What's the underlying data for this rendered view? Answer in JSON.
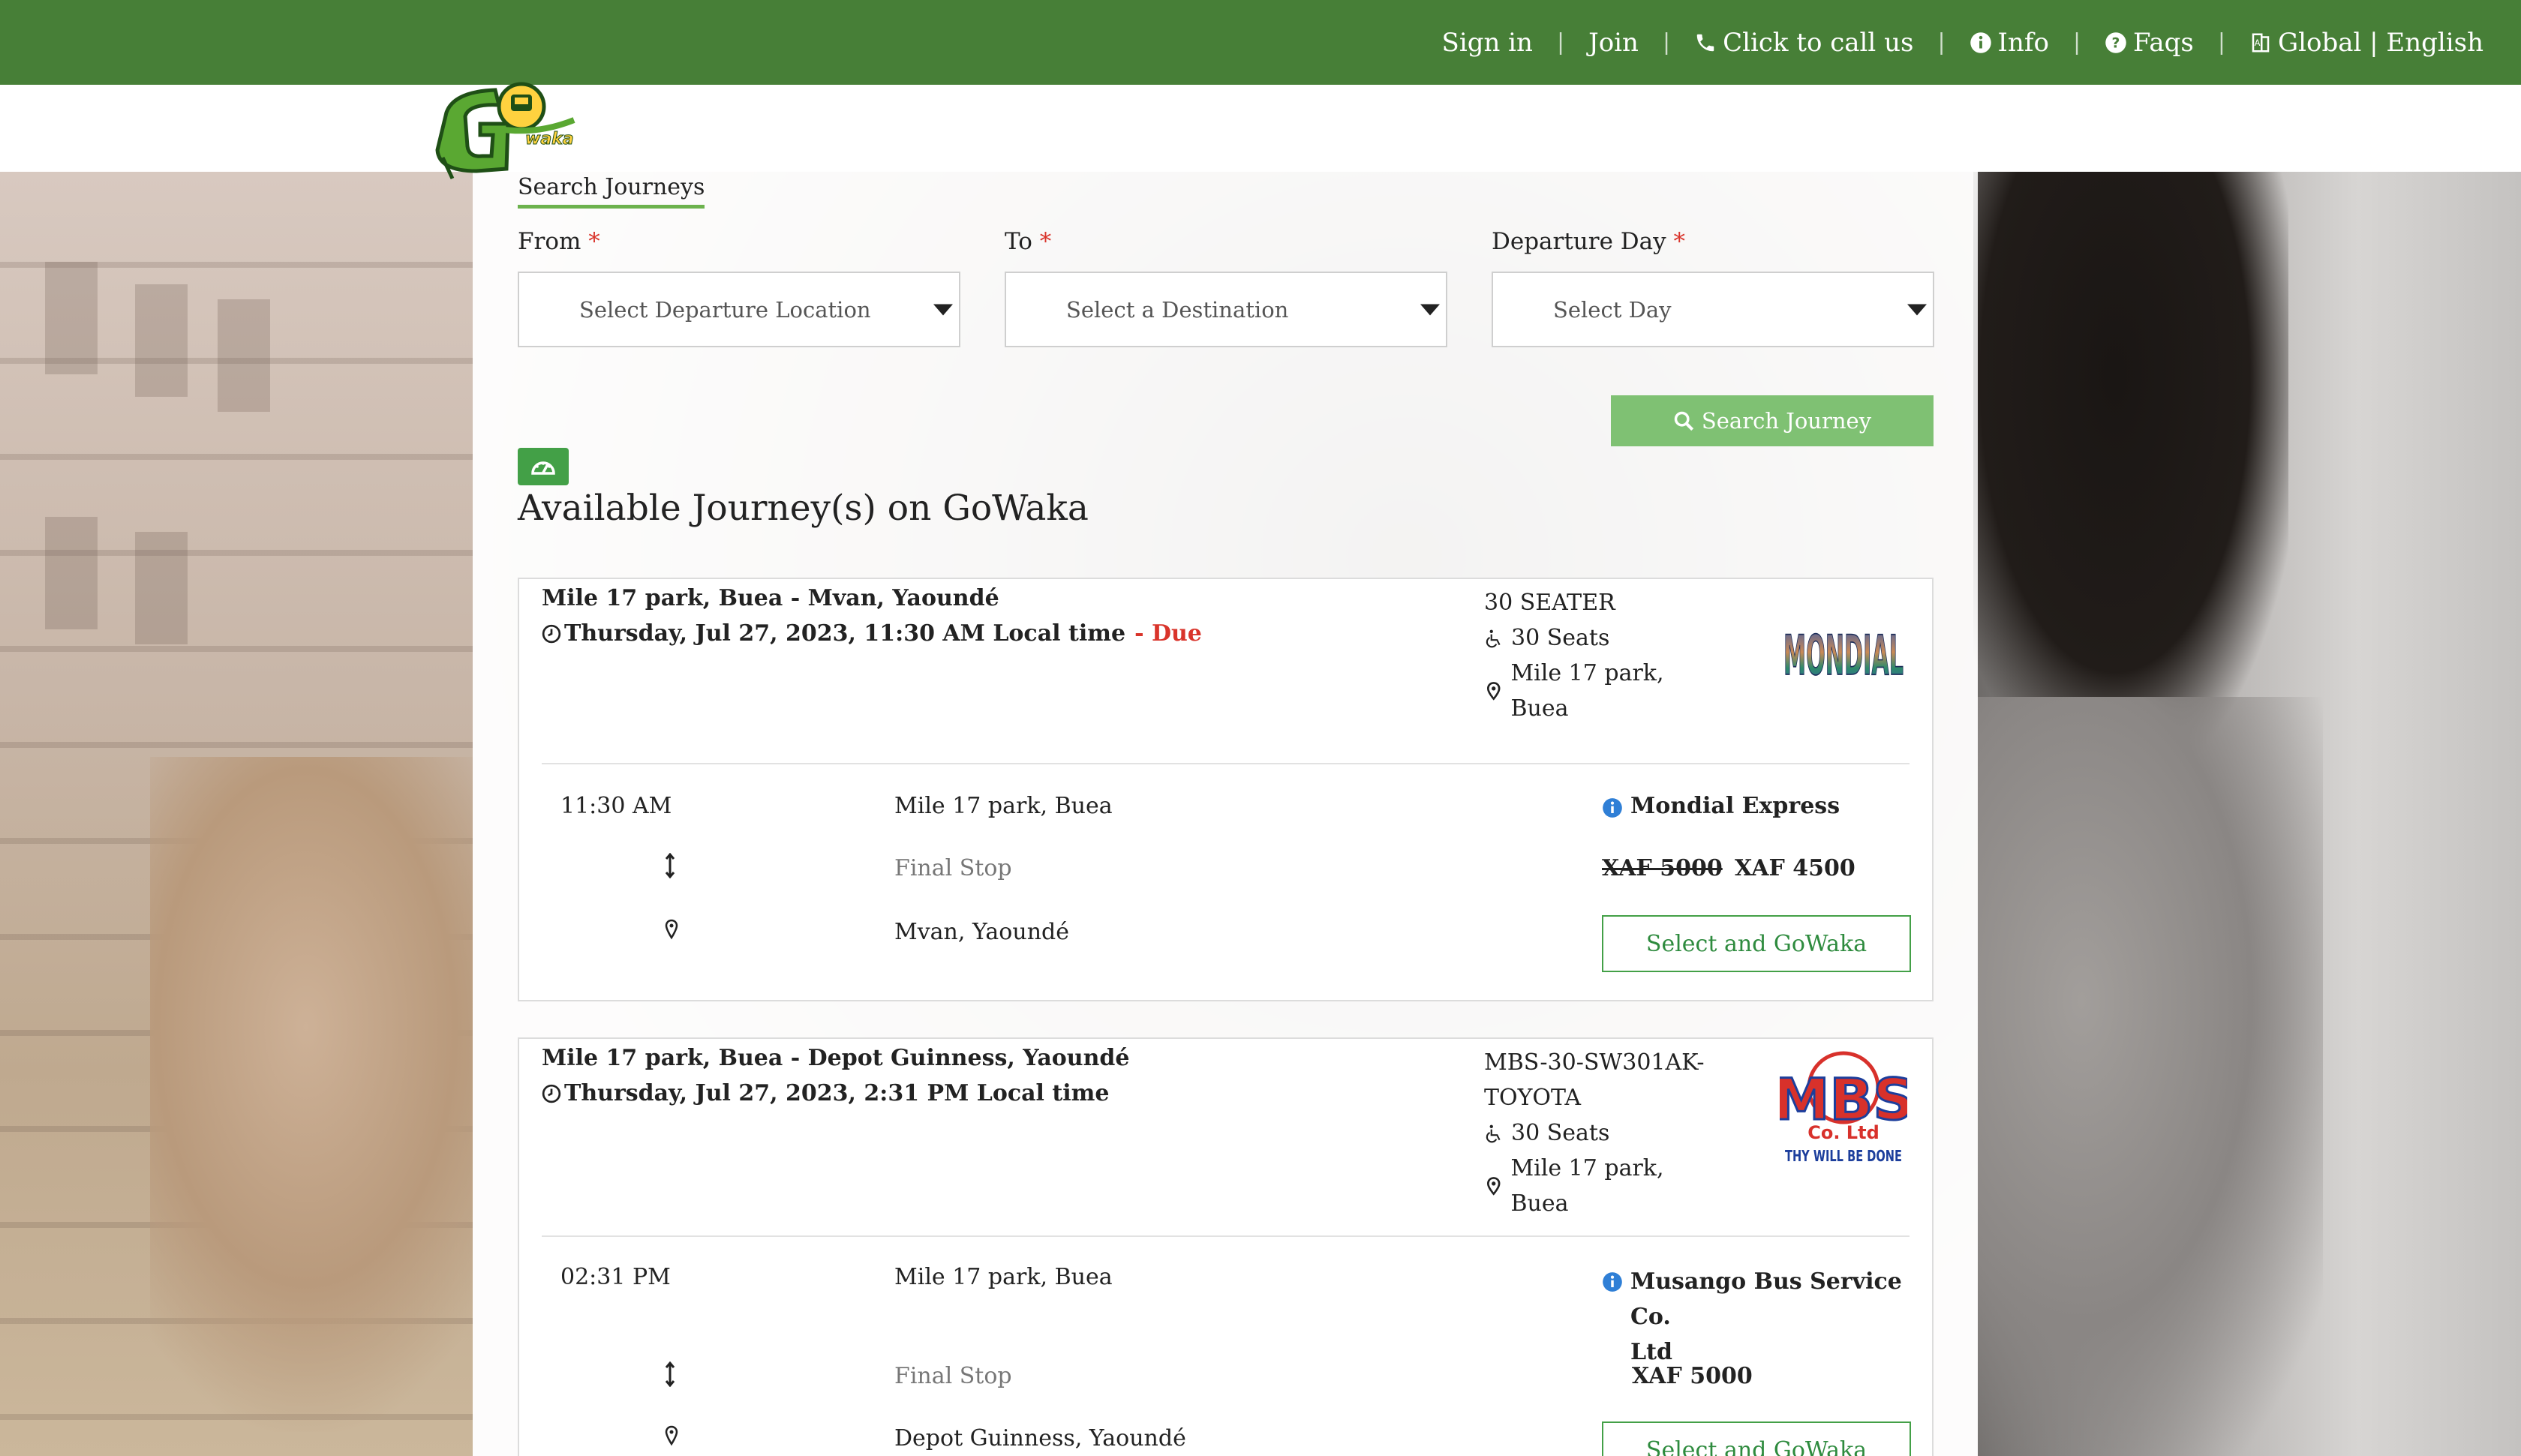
{
  "topbar": {
    "sign_in": "Sign in",
    "join": "Join",
    "call": "Click to call us",
    "info": "Info",
    "faqs": "Faqs",
    "global": "Global | English",
    "separator": "|"
  },
  "logo": {
    "text": "Go",
    "subtext": "waka"
  },
  "search": {
    "tab_label": "Search Journeys",
    "from_label": "From",
    "to_label": "To",
    "day_label": "Departure Day",
    "required_mark": "*",
    "from_placeholder": "Select Departure Location",
    "to_placeholder": "Select a Destination",
    "day_placeholder": "Select Day",
    "button_label": "Search Journey"
  },
  "section_title": "Available Journey(s) on GoWaka",
  "journeys": [
    {
      "route": "Mile 17 park, Buea - Mvan, Yaoundé",
      "departure": "Thursday, Jul 27, 2023, 11:30 AM Local time",
      "due": "- Due",
      "vehicle": "30 SEATER",
      "seats": "30 Seats",
      "park": "Mile 17 park, Buea",
      "logo_text": "MONDIAL",
      "time": "11:30 AM",
      "origin": "Mile 17 park, Buea",
      "final_stop_label": "Final Stop",
      "destination": "Mvan, Yaoundé",
      "operator": "Mondial Express",
      "old_price": "XAF 5000",
      "price": "XAF 4500",
      "select_label": "Select and GoWaka"
    },
    {
      "route": "Mile 17 park, Buea - Depot Guinness, Yaoundé",
      "departure": "Thursday, Jul 27, 2023, 2:31 PM Local time",
      "vehicle_line1": "MBS-30-SW301AK-",
      "vehicle_line2": "TOYOTA",
      "seats": "30 Seats",
      "park": "Mile 17 park, Buea",
      "logo_text": "MBS",
      "logo_sub": "Co. Ltd",
      "logo_tag": "THY WILL BE DONE",
      "time": "02:31 PM",
      "origin": "Mile 17 park, Buea",
      "final_stop_label": "Final Stop",
      "destination": "Depot Guinness, Yaoundé",
      "operator_line1": "Musango Bus Service Co.",
      "operator_line2": "Ltd",
      "price": "XAF 5000",
      "select_label": "Select and GoWaka"
    }
  ],
  "colors": {
    "topbar": "#477f37",
    "accent_green": "#43a047",
    "search_button": "#7fc173",
    "required": "#d9342b",
    "info_icon": "#2f7fd6"
  },
  "icons": [
    "phone-icon",
    "info-icon",
    "question-icon",
    "language-icon",
    "search-icon",
    "dashboard-icon",
    "clock-icon",
    "wheelchair-icon",
    "map-marker-icon",
    "updown-arrow-icon",
    "caret-down-icon"
  ]
}
